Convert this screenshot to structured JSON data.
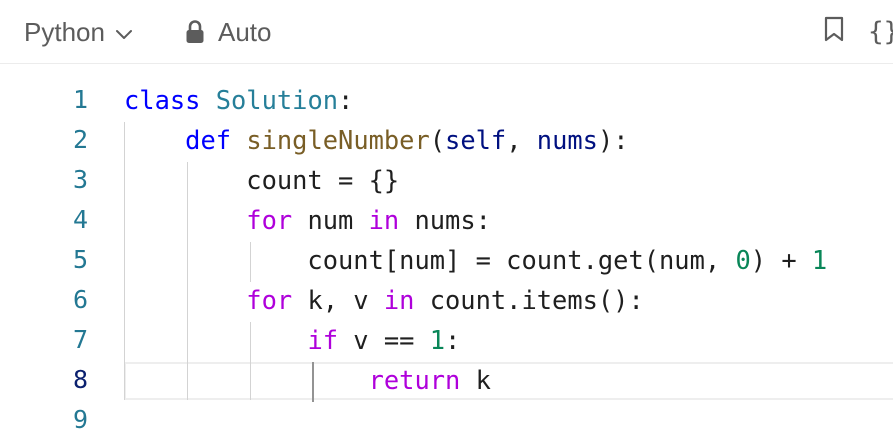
{
  "toolbar": {
    "language_label": "Python",
    "language_chevron_icon": "chevron-down-icon",
    "mode_icon": "lock-icon",
    "mode_label": "Auto",
    "bookmark_icon": "bookmark-icon",
    "format_icon": "braces-icon",
    "format_glyph": "{}"
  },
  "editor": {
    "current_line": 8,
    "lines": [
      {
        "number": "1",
        "tokens": [
          {
            "t": "class",
            "c": "kw-blue"
          },
          {
            "t": " ",
            "c": "plain"
          },
          {
            "t": "Solution",
            "c": "cls"
          },
          {
            "t": ":",
            "c": "plain"
          }
        ]
      },
      {
        "number": "2",
        "tokens": [
          {
            "t": "    ",
            "c": "plain"
          },
          {
            "t": "def",
            "c": "kw-blue"
          },
          {
            "t": " ",
            "c": "plain"
          },
          {
            "t": "singleNumber",
            "c": "fn"
          },
          {
            "t": "(",
            "c": "plain"
          },
          {
            "t": "self",
            "c": "param"
          },
          {
            "t": ", ",
            "c": "plain"
          },
          {
            "t": "nums",
            "c": "param"
          },
          {
            "t": "):",
            "c": "plain"
          }
        ]
      },
      {
        "number": "3",
        "tokens": [
          {
            "t": "        count = {}",
            "c": "plain"
          }
        ]
      },
      {
        "number": "4",
        "tokens": [
          {
            "t": "        ",
            "c": "plain"
          },
          {
            "t": "for",
            "c": "kw"
          },
          {
            "t": " num ",
            "c": "plain"
          },
          {
            "t": "in",
            "c": "kw"
          },
          {
            "t": " nums:",
            "c": "plain"
          }
        ]
      },
      {
        "number": "5",
        "tokens": [
          {
            "t": "            count[num] = count.get(num, ",
            "c": "plain"
          },
          {
            "t": "0",
            "c": "num"
          },
          {
            "t": ") + ",
            "c": "plain"
          },
          {
            "t": "1",
            "c": "num"
          }
        ]
      },
      {
        "number": "6",
        "tokens": [
          {
            "t": "        ",
            "c": "plain"
          },
          {
            "t": "for",
            "c": "kw"
          },
          {
            "t": " k, v ",
            "c": "plain"
          },
          {
            "t": "in",
            "c": "kw"
          },
          {
            "t": " count.items():",
            "c": "plain"
          }
        ]
      },
      {
        "number": "7",
        "tokens": [
          {
            "t": "            ",
            "c": "plain"
          },
          {
            "t": "if",
            "c": "kw"
          },
          {
            "t": " v == ",
            "c": "plain"
          },
          {
            "t": "1",
            "c": "num"
          },
          {
            "t": ":",
            "c": "plain"
          }
        ]
      },
      {
        "number": "8",
        "tokens": [
          {
            "t": "                ",
            "c": "plain"
          },
          {
            "t": "return",
            "c": "kw"
          },
          {
            "t": " k",
            "c": "plain"
          }
        ]
      },
      {
        "number": "9",
        "tokens": []
      }
    ]
  },
  "colors": {
    "keyword": "#af00db",
    "keyword_blue": "#0000ff",
    "class_name": "#267f99",
    "function_name": "#795e26",
    "parameter": "#001080",
    "number": "#098658",
    "line_number": "#237893"
  }
}
